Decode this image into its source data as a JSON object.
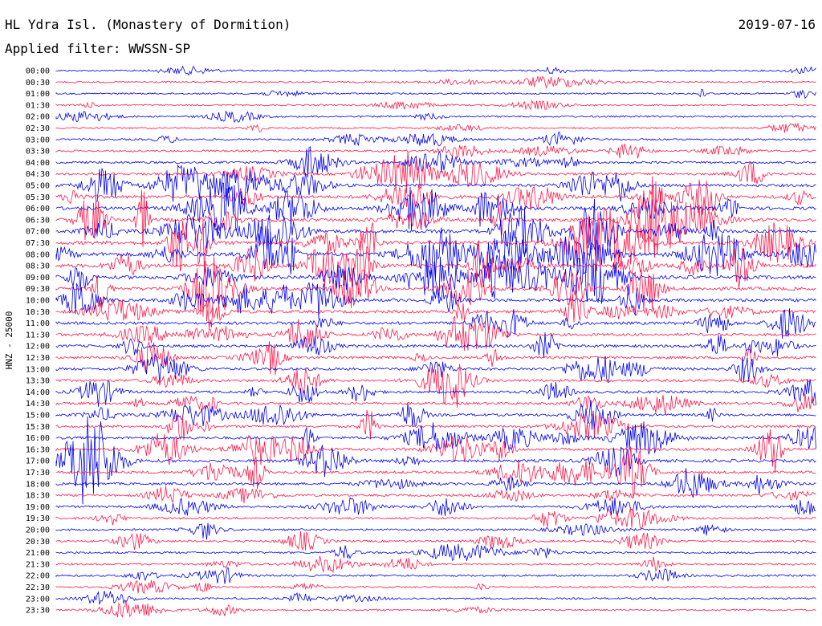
{
  "header": {
    "station": "HL Ydra Isl. (Monastery of Dormition)",
    "date": "2019-07-16",
    "filter": "Applied filter: WWSSN-SP"
  },
  "channel_label": "HNZ - 25000",
  "colors": {
    "even_rows": "#0000ee",
    "odd_rows": "#ff1a4b",
    "background": "#ffffff",
    "text": "#000000"
  },
  "chart_data": {
    "type": "helicorder",
    "title": "HL Ydra Isl. (Monastery of Dormition)",
    "subtitle": "Applied filter: WWSSN-SP",
    "date": "2019-07-16",
    "ylabel": "HNZ - 25000",
    "row_minutes": 30,
    "rows": [
      "00:00",
      "00:30",
      "01:00",
      "01:30",
      "02:00",
      "02:30",
      "03:00",
      "03:30",
      "04:00",
      "04:30",
      "05:00",
      "05:30",
      "06:00",
      "06:30",
      "07:00",
      "07:30",
      "08:00",
      "08:30",
      "09:00",
      "09:30",
      "10:00",
      "10:30",
      "11:00",
      "11:30",
      "12:00",
      "12:30",
      "13:00",
      "13:30",
      "14:00",
      "14:30",
      "15:00",
      "15:30",
      "16:00",
      "16:30",
      "17:00",
      "17:30",
      "18:00",
      "18:30",
      "19:00",
      "19:30",
      "20:00",
      "20:30",
      "21:00",
      "21:30",
      "22:00",
      "22:30",
      "23:00",
      "23:30"
    ],
    "activity_level": [
      0.1,
      0.15,
      0.1,
      0.12,
      0.15,
      0.15,
      0.2,
      0.3,
      0.4,
      0.5,
      0.6,
      0.7,
      0.8,
      0.9,
      0.9,
      0.95,
      1.0,
      0.95,
      0.9,
      0.8,
      0.7,
      0.65,
      0.65,
      0.6,
      0.6,
      0.55,
      0.55,
      0.5,
      0.5,
      0.5,
      0.5,
      0.5,
      0.55,
      0.6,
      0.6,
      0.5,
      0.45,
      0.4,
      0.35,
      0.35,
      0.3,
      0.3,
      0.3,
      0.25,
      0.25,
      0.2,
      0.2,
      0.2
    ],
    "legend": "none"
  }
}
